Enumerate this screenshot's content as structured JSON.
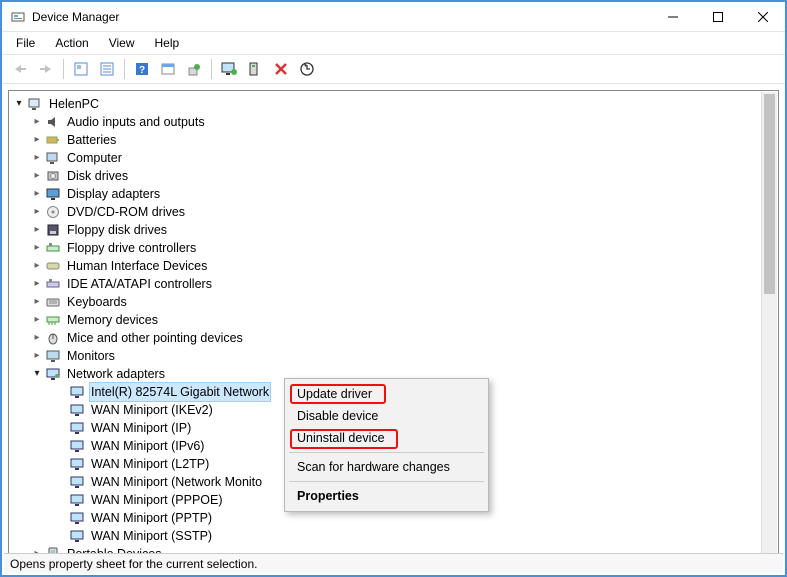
{
  "window": {
    "title": "Device Manager"
  },
  "menu": {
    "file": "File",
    "action": "Action",
    "view": "View",
    "help": "Help"
  },
  "toolbar": {
    "icons": [
      "back",
      "forward",
      "show-hidden",
      "properties",
      "help-icon",
      "calendar",
      "update-driver",
      "monitor",
      "computer",
      "uninstall",
      "scan-hardware"
    ]
  },
  "root": {
    "name": "HelenPC"
  },
  "categories": [
    {
      "icon": "audio",
      "label": "Audio inputs and outputs"
    },
    {
      "icon": "battery",
      "label": "Batteries"
    },
    {
      "icon": "pc",
      "label": "Computer"
    },
    {
      "icon": "disk",
      "label": "Disk drives"
    },
    {
      "icon": "display",
      "label": "Display adapters"
    },
    {
      "icon": "dvd",
      "label": "DVD/CD-ROM drives"
    },
    {
      "icon": "floppy",
      "label": "Floppy disk drives"
    },
    {
      "icon": "floppyctl",
      "label": "Floppy drive controllers"
    },
    {
      "icon": "hid",
      "label": "Human Interface Devices"
    },
    {
      "icon": "ide",
      "label": "IDE ATA/ATAPI controllers"
    },
    {
      "icon": "keyboard",
      "label": "Keyboards"
    },
    {
      "icon": "memory",
      "label": "Memory devices"
    },
    {
      "icon": "mouse",
      "label": "Mice and other pointing devices"
    },
    {
      "icon": "monitor",
      "label": "Monitors"
    }
  ],
  "network": {
    "label": "Network adapters",
    "items": [
      "Intel(R) 82574L Gigabit Network",
      "WAN Miniport (IKEv2)",
      "WAN Miniport (IP)",
      "WAN Miniport (IPv6)",
      "WAN Miniport (L2TP)",
      "WAN Miniport (Network Monitor)",
      "WAN Miniport (PPPOE)",
      "WAN Miniport (PPTP)",
      "WAN Miniport (SSTP)"
    ],
    "selected_index": 0,
    "truncated_display": "WAN Miniport (Network Monito"
  },
  "tail_category": {
    "icon": "portable",
    "label": "Portable Devices"
  },
  "context_menu": {
    "update": "Update driver",
    "disable": "Disable device",
    "uninstall": "Uninstall device",
    "scan": "Scan for hardware changes",
    "properties": "Properties"
  },
  "status": "Opens property sheet for the current selection."
}
